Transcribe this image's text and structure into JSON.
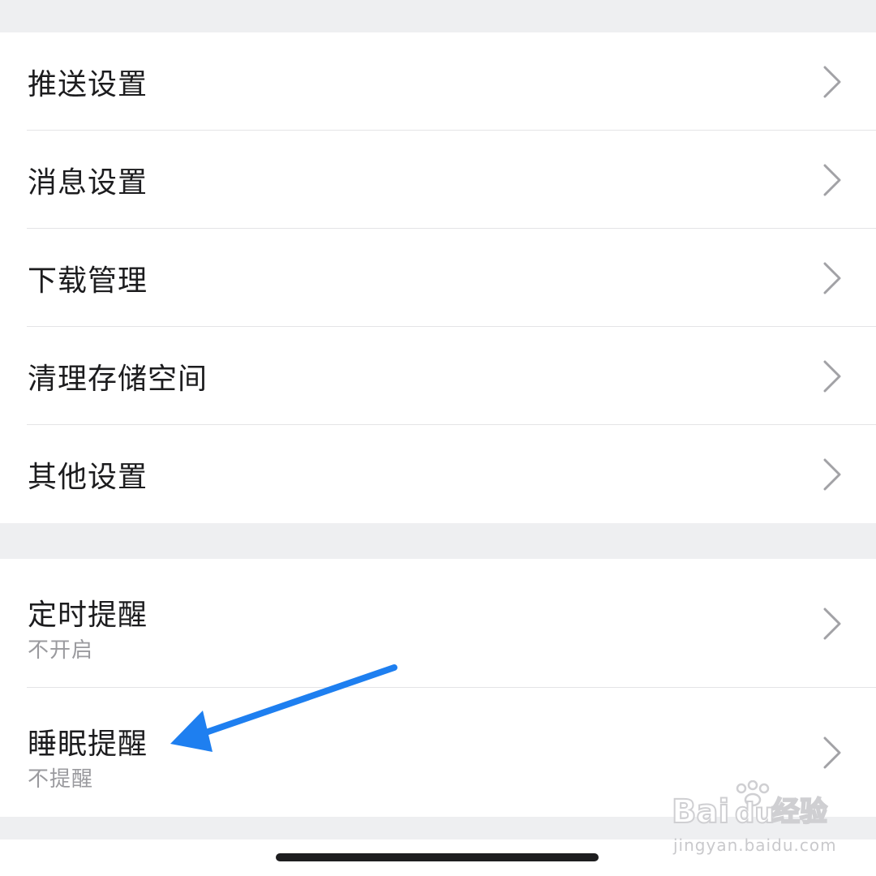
{
  "group1": {
    "items": [
      {
        "label": "推送设置"
      },
      {
        "label": "消息设置"
      },
      {
        "label": "下载管理"
      },
      {
        "label": "清理存储空间"
      },
      {
        "label": "其他设置"
      }
    ]
  },
  "group2": {
    "items": [
      {
        "label": "定时提醒",
        "sub": "不开启"
      },
      {
        "label": "睡眠提醒",
        "sub": "不提醒"
      }
    ]
  },
  "icons": {
    "row_chevron": "chevron-right-icon",
    "annotation": "blue-arrow-icon"
  },
  "colors": {
    "background": "#eeeff1",
    "row": "#ffffff",
    "label": "#1c1c1e",
    "sublabel": "#9a9a9e",
    "chevron": "#a2a2a6",
    "annotation_arrow": "#1e7ff0"
  },
  "watermark": {
    "logo_text": "Bai du 经验",
    "url": "jingyan.baidu.com"
  }
}
